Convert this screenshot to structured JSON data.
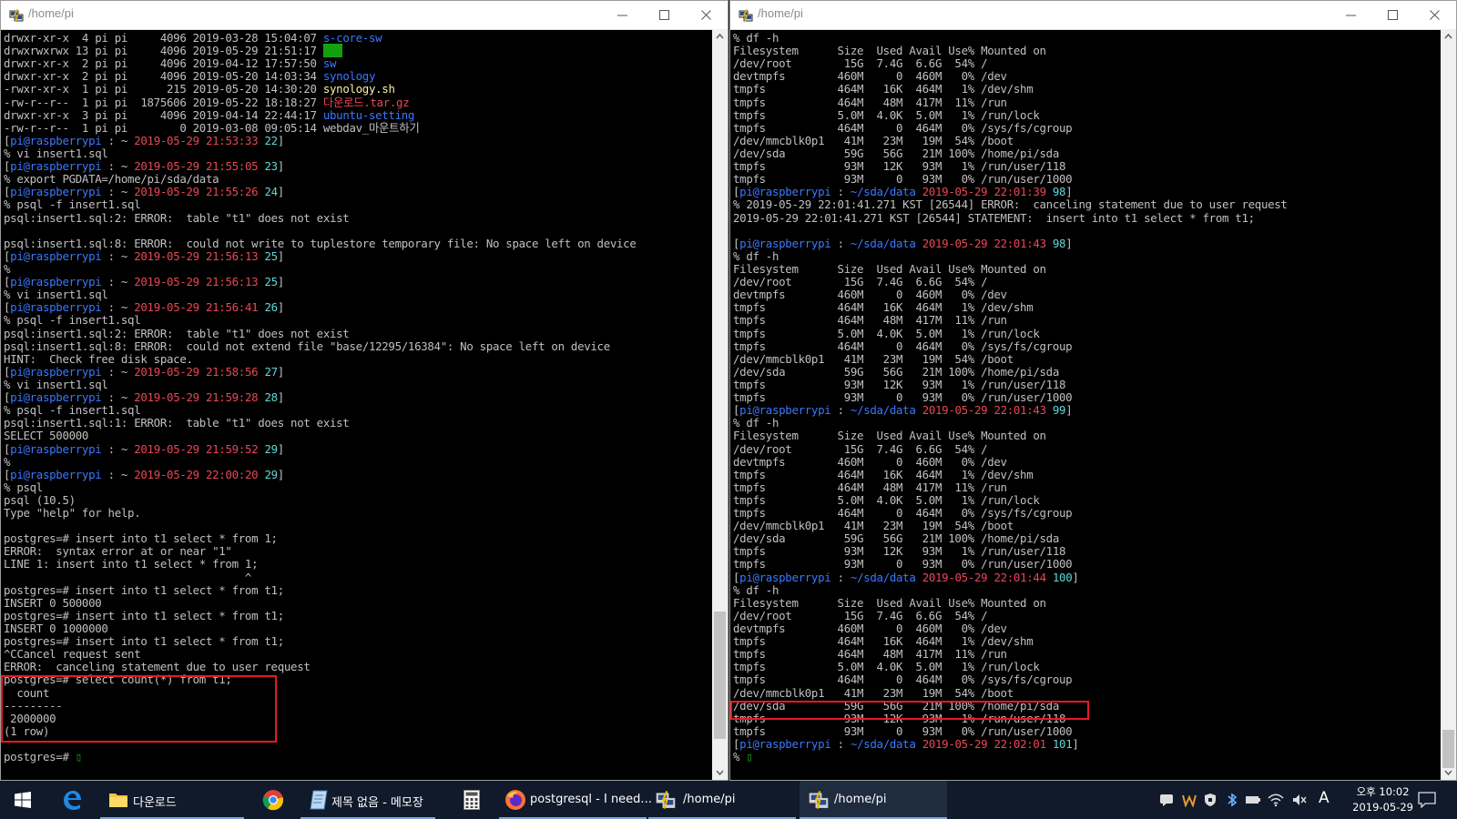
{
  "colors": {
    "default": "#c0c0c0",
    "prompt_user": "#3b78ff",
    "time": "#e74856",
    "cmd_no": "#61d6d6",
    "dir_blue": "#3b78ff",
    "exec_yellow": "#f9f1a5",
    "archive_red": "#e74856",
    "highlight_green_bg": "#13a10e",
    "highlight_box": "#e8191f"
  },
  "left_window": {
    "title": "/home/pi",
    "icon": "putty-icon"
  },
  "right_window": {
    "title": "/home/pi",
    "icon": "putty-icon"
  },
  "left_terminal": [
    [
      [
        "drwxr-xr-x  4 pi pi     4096 2019-03-28 15:04:07 ",
        ""
      ],
      [
        "s-core-sw",
        "b"
      ]
    ],
    [
      [
        "drwxrwxrwx 13 pi pi     4096 2019-05-29 21:51:17 ",
        ""
      ],
      [
        "sda",
        "gbg"
      ]
    ],
    [
      [
        "drwxr-xr-x  2 pi pi     4096 2019-04-12 17:57:50 ",
        ""
      ],
      [
        "sw",
        "b"
      ]
    ],
    [
      [
        "drwxr-xr-x  2 pi pi     4096 2019-05-20 14:03:34 ",
        ""
      ],
      [
        "synology",
        "b"
      ]
    ],
    [
      [
        "-rwxr-xr-x  1 pi pi      215 2019-05-20 14:30:20 ",
        ""
      ],
      [
        "synology.sh",
        "y"
      ]
    ],
    [
      [
        "-rw-r--r--  1 pi pi  1875606 2019-05-22 18:18:27 ",
        ""
      ],
      [
        "다운로드.tar.gz",
        "r"
      ]
    ],
    [
      [
        "drwxr-xr-x  3 pi pi     4096 2019-04-14 22:44:17 ",
        ""
      ],
      [
        "ubuntu-setting",
        "b"
      ]
    ],
    [
      [
        "-rw-r--r--  1 pi pi        0 2019-03-08 09:05:14 webdav_마운트하기",
        ""
      ]
    ],
    [
      [
        "[",
        ""
      ],
      [
        "pi@raspberrypi",
        "b"
      ],
      [
        " : ~ ",
        ""
      ],
      [
        "2019-05-29 21:53:33",
        "r"
      ],
      [
        " 22",
        "c"
      ],
      [
        "]",
        ""
      ]
    ],
    [
      [
        "% vi insert1.sql",
        ""
      ]
    ],
    [
      [
        "[",
        ""
      ],
      [
        "pi@raspberrypi",
        "b"
      ],
      [
        " : ~ ",
        ""
      ],
      [
        "2019-05-29 21:55:05",
        "r"
      ],
      [
        " 23",
        "c"
      ],
      [
        "]",
        ""
      ]
    ],
    [
      [
        "% export PGDATA=/home/pi/sda/data",
        ""
      ]
    ],
    [
      [
        "[",
        ""
      ],
      [
        "pi@raspberrypi",
        "b"
      ],
      [
        " : ~ ",
        ""
      ],
      [
        "2019-05-29 21:55:26",
        "r"
      ],
      [
        " 24",
        "c"
      ],
      [
        "]",
        ""
      ]
    ],
    [
      [
        "% psql -f insert1.sql",
        ""
      ]
    ],
    [
      [
        "psql:insert1.sql:2: ERROR:  table \"t1\" does not exist",
        ""
      ]
    ],
    [
      [
        "",
        ""
      ]
    ],
    [
      [
        "psql:insert1.sql:8: ERROR:  could not write to tuplestore temporary file: No space left on device",
        ""
      ]
    ],
    [
      [
        "[",
        ""
      ],
      [
        "pi@raspberrypi",
        "b"
      ],
      [
        " : ~ ",
        ""
      ],
      [
        "2019-05-29 21:56:13",
        "r"
      ],
      [
        " 25",
        "c"
      ],
      [
        "]",
        ""
      ]
    ],
    [
      [
        "%",
        ""
      ]
    ],
    [
      [
        "[",
        ""
      ],
      [
        "pi@raspberrypi",
        "b"
      ],
      [
        " : ~ ",
        ""
      ],
      [
        "2019-05-29 21:56:13",
        "r"
      ],
      [
        " 25",
        "c"
      ],
      [
        "]",
        ""
      ]
    ],
    [
      [
        "% vi insert1.sql",
        ""
      ]
    ],
    [
      [
        "[",
        ""
      ],
      [
        "pi@raspberrypi",
        "b"
      ],
      [
        " : ~ ",
        ""
      ],
      [
        "2019-05-29 21:56:41",
        "r"
      ],
      [
        " 26",
        "c"
      ],
      [
        "]",
        ""
      ]
    ],
    [
      [
        "% psql -f insert1.sql",
        ""
      ]
    ],
    [
      [
        "psql:insert1.sql:2: ERROR:  table \"t1\" does not exist",
        ""
      ]
    ],
    [
      [
        "psql:insert1.sql:8: ERROR:  could not extend file \"base/12295/16384\": No space left on device",
        ""
      ]
    ],
    [
      [
        "HINT:  Check free disk space.",
        ""
      ]
    ],
    [
      [
        "[",
        ""
      ],
      [
        "pi@raspberrypi",
        "b"
      ],
      [
        " : ~ ",
        ""
      ],
      [
        "2019-05-29 21:58:56",
        "r"
      ],
      [
        " 27",
        "c"
      ],
      [
        "]",
        ""
      ]
    ],
    [
      [
        "% vi insert1.sql",
        ""
      ]
    ],
    [
      [
        "[",
        ""
      ],
      [
        "pi@raspberrypi",
        "b"
      ],
      [
        " : ~ ",
        ""
      ],
      [
        "2019-05-29 21:59:28",
        "r"
      ],
      [
        " 28",
        "c"
      ],
      [
        "]",
        ""
      ]
    ],
    [
      [
        "% psql -f insert1.sql",
        ""
      ]
    ],
    [
      [
        "psql:insert1.sql:1: ERROR:  table \"t1\" does not exist",
        ""
      ]
    ],
    [
      [
        "SELECT 500000",
        ""
      ]
    ],
    [
      [
        "[",
        ""
      ],
      [
        "pi@raspberrypi",
        "b"
      ],
      [
        " : ~ ",
        ""
      ],
      [
        "2019-05-29 21:59:52",
        "r"
      ],
      [
        " 29",
        "c"
      ],
      [
        "]",
        ""
      ]
    ],
    [
      [
        "%",
        ""
      ]
    ],
    [
      [
        "[",
        ""
      ],
      [
        "pi@raspberrypi",
        "b"
      ],
      [
        " : ~ ",
        ""
      ],
      [
        "2019-05-29 22:00:20",
        "r"
      ],
      [
        " 29",
        "c"
      ],
      [
        "]",
        ""
      ]
    ],
    [
      [
        "% psql",
        ""
      ]
    ],
    [
      [
        "psql (10.5)",
        ""
      ]
    ],
    [
      [
        "Type \"help\" for help.",
        ""
      ]
    ],
    [
      [
        "",
        ""
      ]
    ],
    [
      [
        "postgres=# insert into t1 select * from 1;",
        ""
      ]
    ],
    [
      [
        "ERROR:  syntax error at or near \"1\"",
        ""
      ]
    ],
    [
      [
        "LINE 1: insert into t1 select * from 1;",
        ""
      ]
    ],
    [
      [
        "                                     ^",
        ""
      ]
    ],
    [
      [
        "postgres=# insert into t1 select * from t1;",
        ""
      ]
    ],
    [
      [
        "INSERT 0 500000",
        ""
      ]
    ],
    [
      [
        "postgres=# insert into t1 select * from t1;",
        ""
      ]
    ],
    [
      [
        "INSERT 0 1000000",
        ""
      ]
    ],
    [
      [
        "postgres=# insert into t1 select * from t1;",
        ""
      ]
    ],
    [
      [
        "^CCancel request sent",
        ""
      ]
    ],
    [
      [
        "ERROR:  canceling statement due to user request",
        ""
      ]
    ],
    [
      [
        "postgres=# select count(*) from t1;",
        ""
      ]
    ],
    [
      [
        "  count",
        ""
      ]
    ],
    [
      [
        "---------",
        ""
      ]
    ],
    [
      [
        " 2000000",
        ""
      ]
    ],
    [
      [
        "(1 row)",
        ""
      ]
    ],
    [
      [
        "",
        ""
      ]
    ],
    [
      [
        "postgres=# ",
        ""
      ],
      [
        "▯",
        "g"
      ]
    ]
  ],
  "right_terminal": [
    [
      [
        "% df -h",
        ""
      ]
    ],
    [
      [
        "Filesystem      Size  Used Avail Use% Mounted on",
        ""
      ]
    ],
    [
      [
        "/dev/root        15G  7.4G  6.6G  54% /",
        ""
      ]
    ],
    [
      [
        "devtmpfs        460M     0  460M   0% /dev",
        ""
      ]
    ],
    [
      [
        "tmpfs           464M   16K  464M   1% /dev/shm",
        ""
      ]
    ],
    [
      [
        "tmpfs           464M   48M  417M  11% /run",
        ""
      ]
    ],
    [
      [
        "tmpfs           5.0M  4.0K  5.0M   1% /run/lock",
        ""
      ]
    ],
    [
      [
        "tmpfs           464M     0  464M   0% /sys/fs/cgroup",
        ""
      ]
    ],
    [
      [
        "/dev/mmcblk0p1   41M   23M   19M  54% /boot",
        ""
      ]
    ],
    [
      [
        "/dev/sda         59G   56G   21M 100% /home/pi/sda",
        ""
      ]
    ],
    [
      [
        "tmpfs            93M   12K   93M   1% /run/user/118",
        ""
      ]
    ],
    [
      [
        "tmpfs            93M     0   93M   0% /run/user/1000",
        ""
      ]
    ],
    [
      [
        "[",
        ""
      ],
      [
        "pi@raspberrypi",
        "b"
      ],
      [
        " : ",
        ""
      ],
      [
        "~/sda/data",
        "b"
      ],
      [
        " ",
        ""
      ],
      [
        "2019-05-29 22:01:39",
        "r"
      ],
      [
        " 98",
        "c"
      ],
      [
        "]",
        ""
      ]
    ],
    [
      [
        "% 2019-05-29 22:01:41.271 KST [26544] ERROR:  canceling statement due to user request",
        ""
      ]
    ],
    [
      [
        "2019-05-29 22:01:41.271 KST [26544] STATEMENT:  insert into t1 select * from t1;",
        ""
      ]
    ],
    [
      [
        "",
        ""
      ]
    ],
    [
      [
        "[",
        ""
      ],
      [
        "pi@raspberrypi",
        "b"
      ],
      [
        " : ",
        ""
      ],
      [
        "~/sda/data",
        "b"
      ],
      [
        " ",
        ""
      ],
      [
        "2019-05-29 22:01:43",
        "r"
      ],
      [
        " 98",
        "c"
      ],
      [
        "]",
        ""
      ]
    ],
    [
      [
        "% df -h",
        ""
      ]
    ],
    [
      [
        "Filesystem      Size  Used Avail Use% Mounted on",
        ""
      ]
    ],
    [
      [
        "/dev/root        15G  7.4G  6.6G  54% /",
        ""
      ]
    ],
    [
      [
        "devtmpfs        460M     0  460M   0% /dev",
        ""
      ]
    ],
    [
      [
        "tmpfs           464M   16K  464M   1% /dev/shm",
        ""
      ]
    ],
    [
      [
        "tmpfs           464M   48M  417M  11% /run",
        ""
      ]
    ],
    [
      [
        "tmpfs           5.0M  4.0K  5.0M   1% /run/lock",
        ""
      ]
    ],
    [
      [
        "tmpfs           464M     0  464M   0% /sys/fs/cgroup",
        ""
      ]
    ],
    [
      [
        "/dev/mmcblk0p1   41M   23M   19M  54% /boot",
        ""
      ]
    ],
    [
      [
        "/dev/sda         59G   56G   21M 100% /home/pi/sda",
        ""
      ]
    ],
    [
      [
        "tmpfs            93M   12K   93M   1% /run/user/118",
        ""
      ]
    ],
    [
      [
        "tmpfs            93M     0   93M   0% /run/user/1000",
        ""
      ]
    ],
    [
      [
        "[",
        ""
      ],
      [
        "pi@raspberrypi",
        "b"
      ],
      [
        " : ",
        ""
      ],
      [
        "~/sda/data",
        "b"
      ],
      [
        " ",
        ""
      ],
      [
        "2019-05-29 22:01:43",
        "r"
      ],
      [
        " 99",
        "c"
      ],
      [
        "]",
        ""
      ]
    ],
    [
      [
        "% df -h",
        ""
      ]
    ],
    [
      [
        "Filesystem      Size  Used Avail Use% Mounted on",
        ""
      ]
    ],
    [
      [
        "/dev/root        15G  7.4G  6.6G  54% /",
        ""
      ]
    ],
    [
      [
        "devtmpfs        460M     0  460M   0% /dev",
        ""
      ]
    ],
    [
      [
        "tmpfs           464M   16K  464M   1% /dev/shm",
        ""
      ]
    ],
    [
      [
        "tmpfs           464M   48M  417M  11% /run",
        ""
      ]
    ],
    [
      [
        "tmpfs           5.0M  4.0K  5.0M   1% /run/lock",
        ""
      ]
    ],
    [
      [
        "tmpfs           464M     0  464M   0% /sys/fs/cgroup",
        ""
      ]
    ],
    [
      [
        "/dev/mmcblk0p1   41M   23M   19M  54% /boot",
        ""
      ]
    ],
    [
      [
        "/dev/sda         59G   56G   21M 100% /home/pi/sda",
        ""
      ]
    ],
    [
      [
        "tmpfs            93M   12K   93M   1% /run/user/118",
        ""
      ]
    ],
    [
      [
        "tmpfs            93M     0   93M   0% /run/user/1000",
        ""
      ]
    ],
    [
      [
        "[",
        ""
      ],
      [
        "pi@raspberrypi",
        "b"
      ],
      [
        " : ",
        ""
      ],
      [
        "~/sda/data",
        "b"
      ],
      [
        " ",
        ""
      ],
      [
        "2019-05-29 22:01:44",
        "r"
      ],
      [
        " 100",
        "c"
      ],
      [
        "]",
        ""
      ]
    ],
    [
      [
        "% df -h",
        ""
      ]
    ],
    [
      [
        "Filesystem      Size  Used Avail Use% Mounted on",
        ""
      ]
    ],
    [
      [
        "/dev/root        15G  7.4G  6.6G  54% /",
        ""
      ]
    ],
    [
      [
        "devtmpfs        460M     0  460M   0% /dev",
        ""
      ]
    ],
    [
      [
        "tmpfs           464M   16K  464M   1% /dev/shm",
        ""
      ]
    ],
    [
      [
        "tmpfs           464M   48M  417M  11% /run",
        ""
      ]
    ],
    [
      [
        "tmpfs           5.0M  4.0K  5.0M   1% /run/lock",
        ""
      ]
    ],
    [
      [
        "tmpfs           464M     0  464M   0% /sys/fs/cgroup",
        ""
      ]
    ],
    [
      [
        "/dev/mmcblk0p1   41M   23M   19M  54% /boot",
        ""
      ]
    ],
    [
      [
        "/dev/sda         59G   56G   21M 100% /home/pi/sda",
        ""
      ]
    ],
    [
      [
        "tmpfs            93M   12K   93M   1% /run/user/118",
        ""
      ]
    ],
    [
      [
        "tmpfs            93M     0   93M   0% /run/user/1000",
        ""
      ]
    ],
    [
      [
        "[",
        ""
      ],
      [
        "pi@raspberrypi",
        "b"
      ],
      [
        " : ",
        ""
      ],
      [
        "~/sda/data",
        "b"
      ],
      [
        " ",
        ""
      ],
      [
        "2019-05-29 22:02:01",
        "r"
      ],
      [
        " 101",
        "c"
      ],
      [
        "]",
        ""
      ]
    ],
    [
      [
        "% ",
        ""
      ],
      [
        "▯",
        "g"
      ]
    ]
  ],
  "taskbar": {
    "start_icon": "windows-start-icon",
    "items": [
      {
        "name": "edge-browser",
        "icon": "edge-icon",
        "label": ""
      },
      {
        "name": "downloads-folder",
        "icon": "folder-icon",
        "label": "다운로드"
      },
      {
        "name": "chrome",
        "icon": "chrome-icon",
        "label": ""
      },
      {
        "name": "notepad",
        "icon": "notepad-icon",
        "label": "제목 없음 - 메모장"
      },
      {
        "name": "calculator",
        "icon": "calculator-icon",
        "label": ""
      },
      {
        "name": "firefox",
        "icon": "firefox-icon",
        "label": "postgresql - I need..."
      },
      {
        "name": "putty-1",
        "icon": "putty-icon",
        "label": "/home/pi"
      },
      {
        "name": "putty-2",
        "icon": "putty-icon",
        "label": "/home/pi"
      }
    ],
    "tray": {
      "ime": "A",
      "clock_time": "오후 10:02",
      "clock_date": "2019-05-29"
    }
  }
}
